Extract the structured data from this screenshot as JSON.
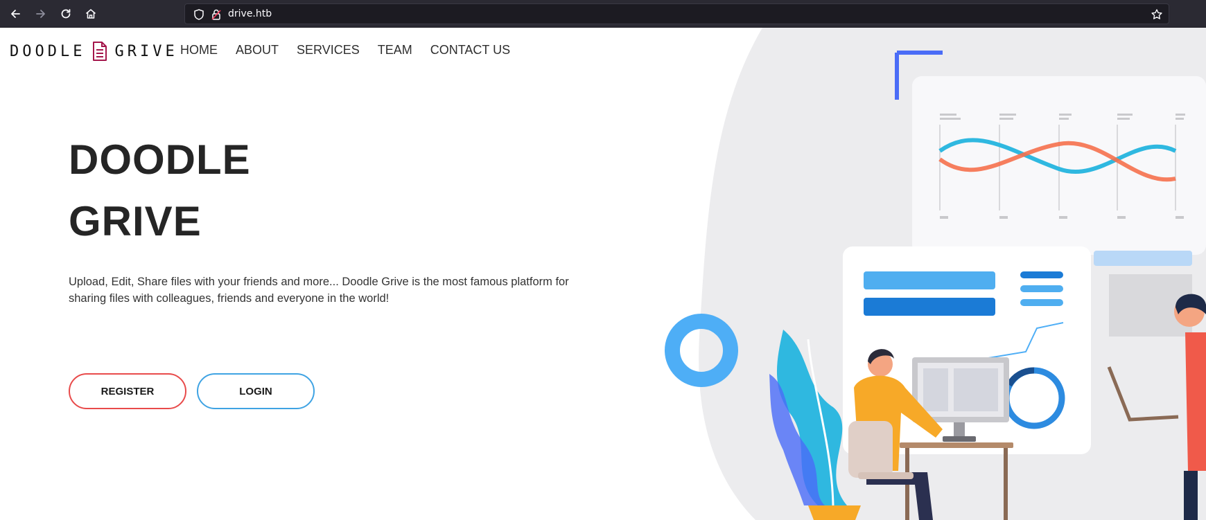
{
  "browser": {
    "url": "drive.htb"
  },
  "logo": {
    "word_left": "DOODLE",
    "word_right": "GRIVE"
  },
  "nav": {
    "items": [
      "HOME",
      "ABOUT",
      "SERVICES",
      "TEAM",
      "CONTACT US"
    ]
  },
  "hero": {
    "title_line1": "DOODLE",
    "title_line2": "GRIVE",
    "desc_line1": "Upload, Edit, Share files with your friends and more... Doodle Grive is the most famous platform for",
    "desc_line2": "sharing files with colleagues, friends and everyone in the world!",
    "register_label": "REGISTER",
    "login_label": "LOGIN"
  },
  "colors": {
    "register_border": "#e84a4a",
    "login_border": "#3fa3e3",
    "logo_doc": "#a4164b"
  },
  "icons": {
    "back": "arrow-left-icon",
    "forward": "arrow-right-icon",
    "reload": "reload-icon",
    "home": "home-icon",
    "shield": "shield-icon",
    "lock": "lock-icon",
    "bookmark": "star-icon"
  }
}
